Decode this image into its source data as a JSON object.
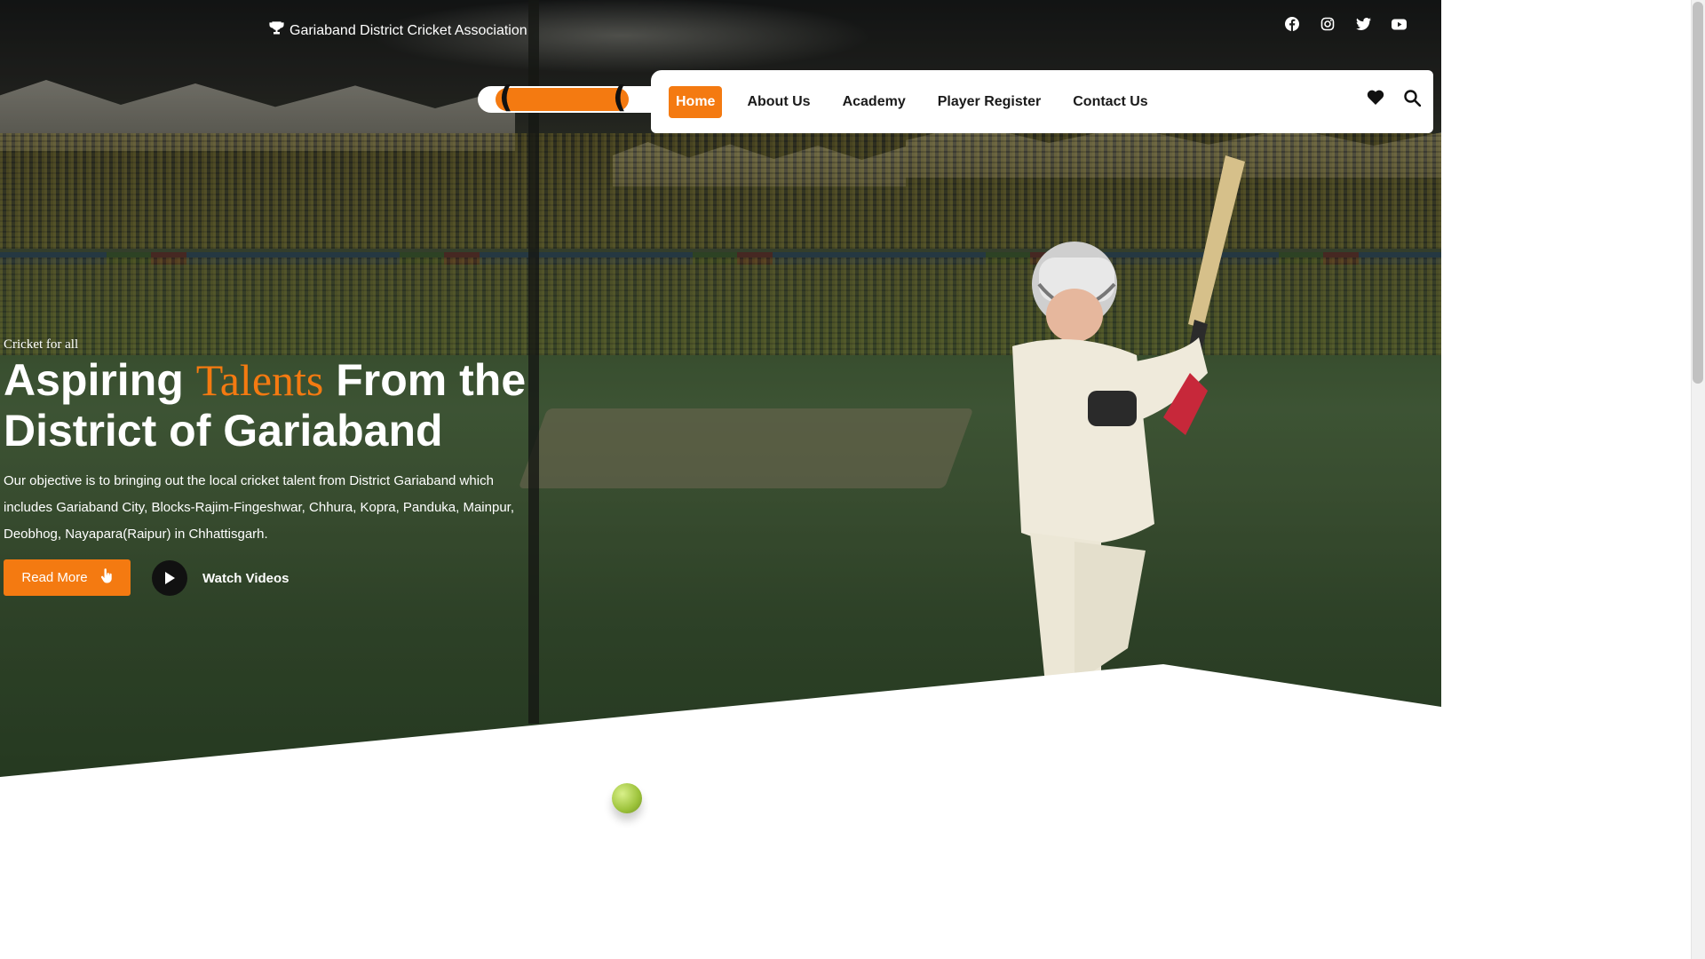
{
  "topbar": {
    "association": "Gariaband District Cricket Association",
    "trophy_icon": "trophy-icon",
    "social": [
      "facebook-icon",
      "instagram-icon",
      "twitter-icon",
      "youtube-icon"
    ]
  },
  "nav": {
    "items": [
      {
        "label": "Home",
        "active": true
      },
      {
        "label": "About Us",
        "active": false
      },
      {
        "label": "Academy",
        "active": false
      },
      {
        "label": "Player Register",
        "active": false
      },
      {
        "label": "Contact Us",
        "active": false
      }
    ],
    "icons": [
      "heart-icon",
      "search-icon"
    ]
  },
  "hero": {
    "tagline": "Cricket for all",
    "headline_part1": "Aspiring ",
    "headline_accent": "Talents",
    "headline_part2": " From the District of Gariaband",
    "description": "Our objective is to bringing out the local cricket talent from District Gariaband which includes Gariaband City, Blocks-Rajim-Fingeshwar, Chhura, Kopra, Panduka, Mainpur, Deobhog, Nayapara(Raipur) in Chhattisgarh.",
    "read_more": "Read More",
    "watch_videos": "Watch Videos"
  },
  "colors": {
    "accent": "#f47a11",
    "nav_text": "#1a1a1a",
    "white": "#ffffff"
  }
}
